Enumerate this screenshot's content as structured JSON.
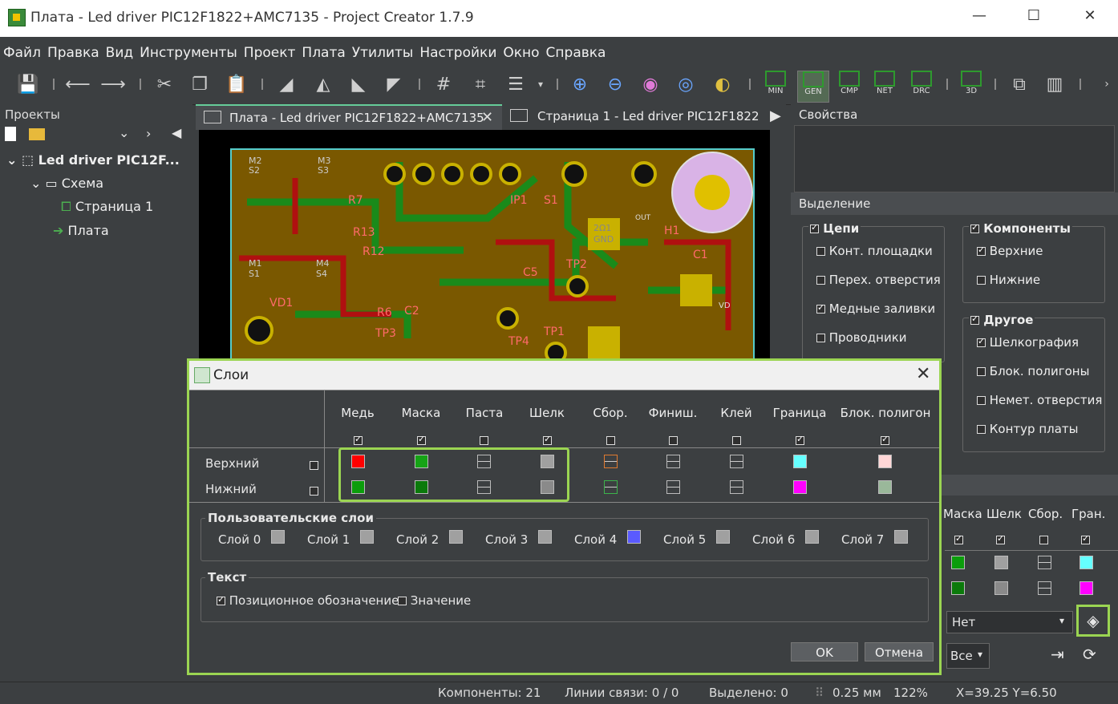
{
  "window": {
    "title": "Плата - Led driver PIC12F1822+AMC7135 - Project Creator 1.7.9"
  },
  "menu": [
    "Файл",
    "Правка",
    "Вид",
    "Инструменты",
    "Проект",
    "Плата",
    "Утилиты",
    "Настройки",
    "Окно",
    "Справка"
  ],
  "toolbar": {
    "min": "MIN",
    "gen": "GEN",
    "cmp": "CMP",
    "net": "NET",
    "drc": "DRC",
    "three_d": "3D"
  },
  "projects": {
    "header": "Проекты",
    "tree": [
      "Led driver PIC12F...",
      "Схема",
      "Страница 1",
      "Плата"
    ]
  },
  "tabs": [
    "Плата - Led driver PIC12F1822+AMC7135",
    "Страница 1 - Led driver PIC12F1822"
  ],
  "pcb_labels": [
    "M2",
    "S2",
    "M3",
    "S3",
    "R7",
    "R13",
    "R12",
    "IP1",
    "S1",
    "M1",
    "S1",
    "M4",
    "S4",
    "VD1",
    "R6",
    "C2",
    "TP3",
    "C5",
    "TP2",
    "TP4",
    "TP1",
    "H1",
    "C1",
    "2Ω1",
    "GND",
    "VD",
    "OUT"
  ],
  "properties": {
    "header": "Свойства",
    "selection_header": "Выделение",
    "nets": {
      "label": "Цепи",
      "items": [
        "Конт. площадки",
        "Перех. отверстия",
        "Медные заливки",
        "Проводники"
      ],
      "checked": [
        false,
        false,
        true,
        false
      ]
    },
    "components": {
      "label": "Компоненты",
      "items": [
        "Верхние",
        "Нижние"
      ],
      "checked": [
        true,
        false
      ]
    },
    "other": {
      "label": "Другое",
      "items": [
        "Шелкография",
        "Блок. полигоны",
        "Немет. отверстия",
        "Контур платы"
      ],
      "checked": [
        true,
        false,
        false,
        false
      ]
    },
    "layers_cols": [
      "Маска",
      "Шелк",
      "Сбор.",
      "Гран."
    ],
    "combo_value": "Нет",
    "combo2_value": "Все"
  },
  "dialog": {
    "title": "Слои",
    "columns": [
      "Медь",
      "Маска",
      "Паста",
      "Шелк",
      "Сбор.",
      "Финиш.",
      "Клей",
      "Граница",
      "Блок. полигон"
    ],
    "col_checked": [
      true,
      true,
      false,
      true,
      false,
      false,
      false,
      true,
      true
    ],
    "rows": [
      "Верхний",
      "Нижний"
    ],
    "top_colors": [
      "#ff0000",
      "#16a316",
      "none",
      "#a0a0a0",
      "orange-line",
      "none",
      "none",
      "#66ffff",
      "#ffd6d6"
    ],
    "bottom_colors": [
      "#0b9d0b",
      "#0b7a0b",
      "none",
      "#8a8a8a",
      "green-line",
      "none",
      "none",
      "#ff00ff",
      "#9ab89a"
    ],
    "user_layers_title": "Пользовательские слои",
    "user_layers": [
      "Слой 0",
      "Слой 1",
      "Слой 2",
      "Слой 3",
      "Слой 4",
      "Слой 5",
      "Слой 6",
      "Слой 7"
    ],
    "user_layer_colors": [
      "#a0a0a0",
      "#a0a0a0",
      "#a0a0a0",
      "#a0a0a0",
      "#5a5aff",
      "#a0a0a0",
      "#a0a0a0",
      "#a0a0a0"
    ],
    "text_title": "Текст",
    "text_opts": [
      "Позиционное обозначение",
      "Значение"
    ],
    "ok": "OK",
    "cancel": "Отмена"
  },
  "status": {
    "components": "Компоненты: 21",
    "links": "Линии связи: 0 / 0",
    "selected": "Выделено: 0",
    "grid": "0.25 мм",
    "zoom": "122%",
    "coords": "X=39.25  Y=6.50"
  }
}
